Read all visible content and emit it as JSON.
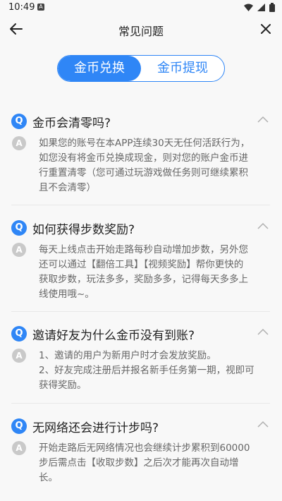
{
  "status_bar": {
    "time": "10:49",
    "app_icon_letter": "A"
  },
  "header": {
    "title": "常见问题",
    "back_icon": "back-arrow-icon",
    "close_icon": "close-icon"
  },
  "tabs": [
    {
      "label": "金币兑换",
      "active": true
    },
    {
      "label": "金币提现",
      "active": false
    }
  ],
  "colors": {
    "accent": "#2f86f6",
    "answer_badge": "#c9c9c9",
    "background": "#f8f8f8"
  },
  "faqs": [
    {
      "q_badge": "Q",
      "question": "金币会清零吗?",
      "a_badge": "A",
      "answer": "如果您的账号在本APP连续30天无任何活跃行为，\n如您没有将金币兑换成现金，则对您的账户金币进\n行重置清零（您可通过玩游戏做任务则可继续累积\n且不会清零）"
    },
    {
      "q_badge": "Q",
      "question": "如何获得步数奖励?",
      "a_badge": "A",
      "answer": "每天上线点击开始走路每秒自动增加步数，另外您\n还可以通过【翻倍工具】【视频奖励】帮你更快的\n获取步数，玩法多多，奖励多多，记得每天多多上\n线使用哦~。"
    },
    {
      "q_badge": "Q",
      "question": "邀请好友为什么金币没有到账?",
      "a_badge": "A",
      "answer": "1、邀请的用户为新用户时才会发放奖励。\n2、好友完成注册后并报名新手任务第一期，视即可\n获得奖励。"
    },
    {
      "q_badge": "Q",
      "question": "无网络还会进行计步吗?",
      "a_badge": "A",
      "answer": "开始走路后无网络情况也会继续计步累积到60000\n步后需点击【收取步数】之后次才能再次自动增\n长。"
    }
  ]
}
